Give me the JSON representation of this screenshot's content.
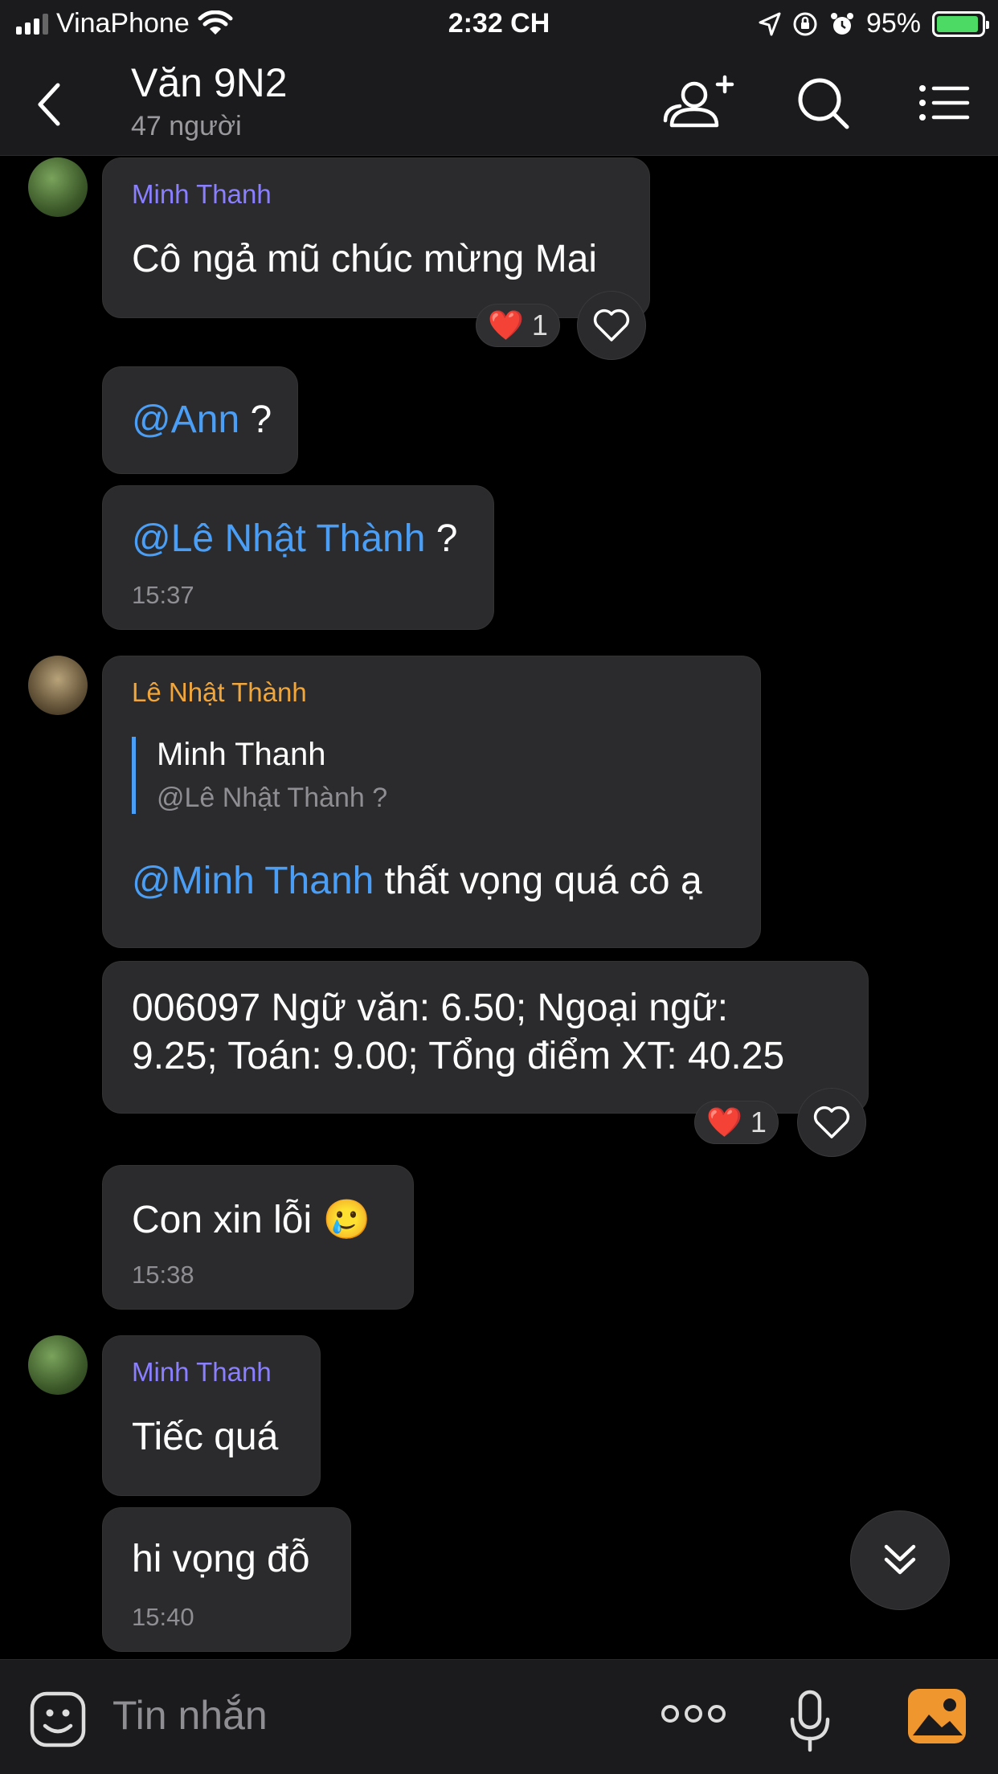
{
  "status": {
    "carrier": "VinaPhone",
    "time": "2:32 CH",
    "battery": "95%",
    "battery_level": 0.95
  },
  "header": {
    "title": "Văn 9N2",
    "subtitle": "47 người",
    "icons": [
      "back-icon",
      "add-member-icon",
      "search-icon",
      "menu-icon"
    ]
  },
  "messages": {
    "m1": {
      "sender": "Minh Thanh",
      "text": "Cô ngả mũ chúc mừng Mai",
      "reaction_count": "1"
    },
    "m2": {
      "mention": "@Ann",
      "text": " ?"
    },
    "m3": {
      "mention": "@Lê Nhật Thành",
      "text": " ?",
      "time": "15:37"
    },
    "m4": {
      "sender": "Lê Nhật Thành",
      "quote_name": "Minh Thanh",
      "quote_text": "@Lê Nhật Thành ?",
      "mention": "@Minh Thanh",
      "text": " thất vọng quá cô ạ"
    },
    "m5": {
      "line1": "006097 Ngữ văn: 6.50; Ngoại ngữ:",
      "line2": "9.25; Toán:  9.00; Tổng điểm XT: 40.25",
      "reaction_count": "1"
    },
    "m6": {
      "text": "Con xin lỗi 🥲",
      "time": "15:38"
    },
    "m7": {
      "sender": "Minh Thanh",
      "text": "Tiếc quá"
    },
    "m8": {
      "text": "hi vọng đỗ",
      "time": "15:40"
    }
  },
  "composer": {
    "placeholder": "Tin nhắn",
    "icons": [
      "emoji-icon",
      "more-icon",
      "microphone-icon",
      "image-icon"
    ]
  }
}
